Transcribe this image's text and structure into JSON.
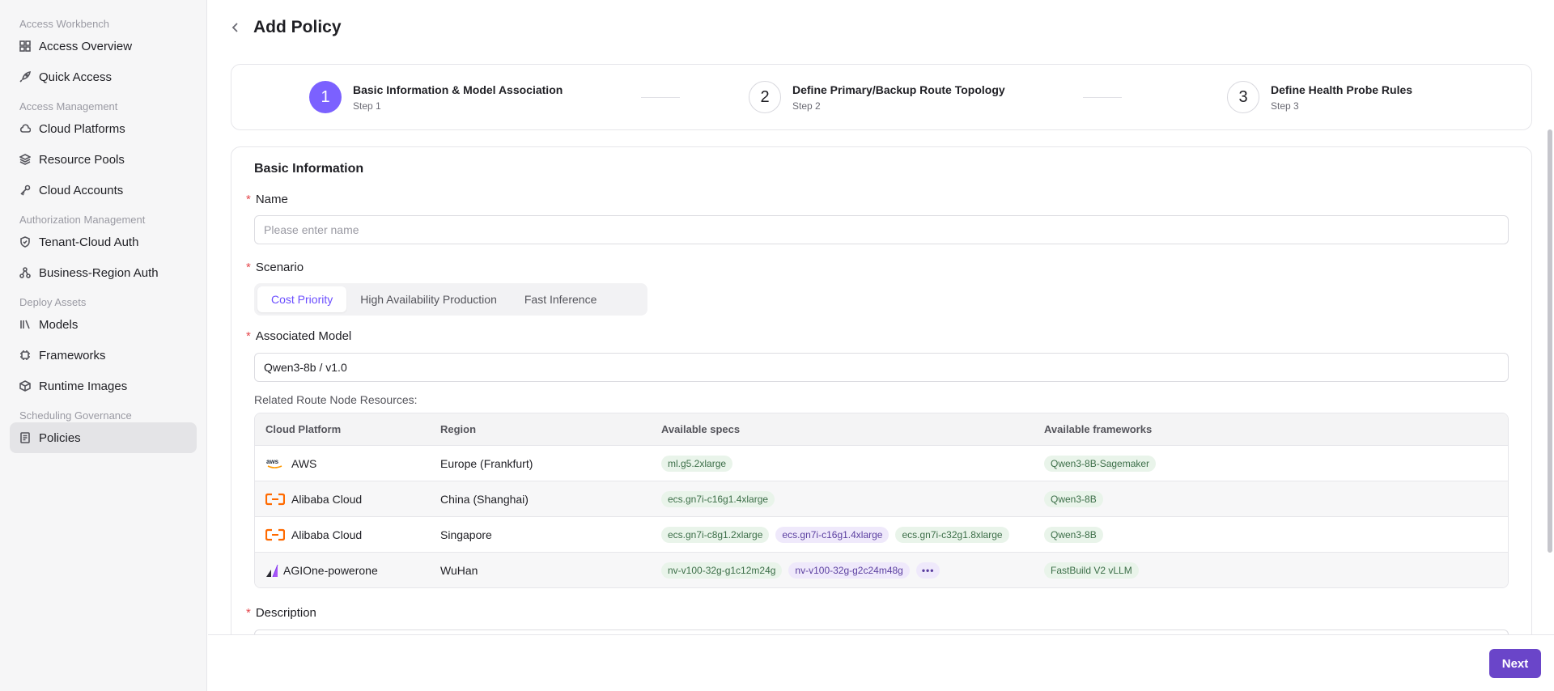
{
  "sidebar": {
    "sections": [
      {
        "title": "Access Workbench",
        "items": [
          {
            "label": "Access Overview",
            "icon": "grid-icon"
          },
          {
            "label": "Quick Access",
            "icon": "rocket-icon"
          }
        ]
      },
      {
        "title": "Access Management",
        "items": [
          {
            "label": "Cloud Platforms",
            "icon": "cloud-icon"
          },
          {
            "label": "Resource Pools",
            "icon": "layers-icon"
          },
          {
            "label": "Cloud Accounts",
            "icon": "key-icon"
          }
        ]
      },
      {
        "title": "Authorization Management",
        "items": [
          {
            "label": "Tenant-Cloud Auth",
            "icon": "shield-icon"
          },
          {
            "label": "Business-Region Auth",
            "icon": "network-icon"
          }
        ]
      },
      {
        "title": "Deploy Assets",
        "items": [
          {
            "label": "Models",
            "icon": "library-icon"
          },
          {
            "label": "Frameworks",
            "icon": "chip-icon"
          },
          {
            "label": "Runtime Images",
            "icon": "box-icon"
          }
        ]
      },
      {
        "title": "Scheduling Governance",
        "items": [
          {
            "label": "Policies",
            "icon": "policy-icon",
            "active": true
          }
        ]
      }
    ]
  },
  "header": {
    "title": "Add Policy"
  },
  "steps": [
    {
      "number": "1",
      "title": "Basic Information & Model Association",
      "subtitle": "Step 1",
      "active": true
    },
    {
      "number": "2",
      "title": "Define Primary/Backup Route Topology",
      "subtitle": "Step 2",
      "active": false
    },
    {
      "number": "3",
      "title": "Define Health Probe Rules",
      "subtitle": "Step 3",
      "active": false
    }
  ],
  "form": {
    "section_title": "Basic Information",
    "required_mark": "*",
    "name_label": "Name",
    "name_placeholder": "Please enter name",
    "scenario_label": "Scenario",
    "scenarios": [
      "Cost Priority",
      "High Availability Production",
      "Fast Inference"
    ],
    "scenario_selected": "Cost Priority",
    "model_label": "Associated Model",
    "model_value": "Qwen3-8b / v1.0",
    "related_label": "Related Route Node Resources:",
    "description_label": "Description"
  },
  "table": {
    "headers": [
      "Cloud Platform",
      "Region",
      "Available specs",
      "Available frameworks"
    ],
    "rows": [
      {
        "platform": "AWS",
        "logo": "aws-logo-icon",
        "region": "Europe (Frankfurt)",
        "specs": [
          "ml.g5.2xlarge"
        ],
        "spec_colors": [
          "g"
        ],
        "frameworks": [
          "Qwen3-8B-Sagemaker"
        ]
      },
      {
        "platform": "Alibaba Cloud",
        "logo": "alibaba-cloud-logo-icon",
        "region": "China (Shanghai)",
        "specs": [
          "ecs.gn7i-c16g1.4xlarge"
        ],
        "spec_colors": [
          "g"
        ],
        "frameworks": [
          "Qwen3-8B"
        ]
      },
      {
        "platform": "Alibaba Cloud",
        "logo": "alibaba-cloud-logo-icon",
        "region": "Singapore",
        "specs": [
          "ecs.gn7i-c8g1.2xlarge",
          "ecs.gn7i-c16g1.4xlarge",
          "ecs.gn7i-c32g1.8xlarge"
        ],
        "spec_colors": [
          "g",
          "p",
          "g"
        ],
        "frameworks": [
          "Qwen3-8B"
        ]
      },
      {
        "platform": "AGIOne-powerone",
        "logo": "agione-logo-icon",
        "region": "WuHan",
        "specs": [
          "nv-v100-32g-g1c12m24g",
          "nv-v100-32g-g2c24m48g"
        ],
        "spec_colors": [
          "g",
          "p"
        ],
        "more": "•••",
        "frameworks": [
          "FastBuild V2 vLLM"
        ]
      }
    ]
  },
  "footer": {
    "next_label": "Next"
  },
  "colors": {
    "accent": "#7b61ff",
    "primary_button": "#6a45c9",
    "required": "#e5484d"
  }
}
